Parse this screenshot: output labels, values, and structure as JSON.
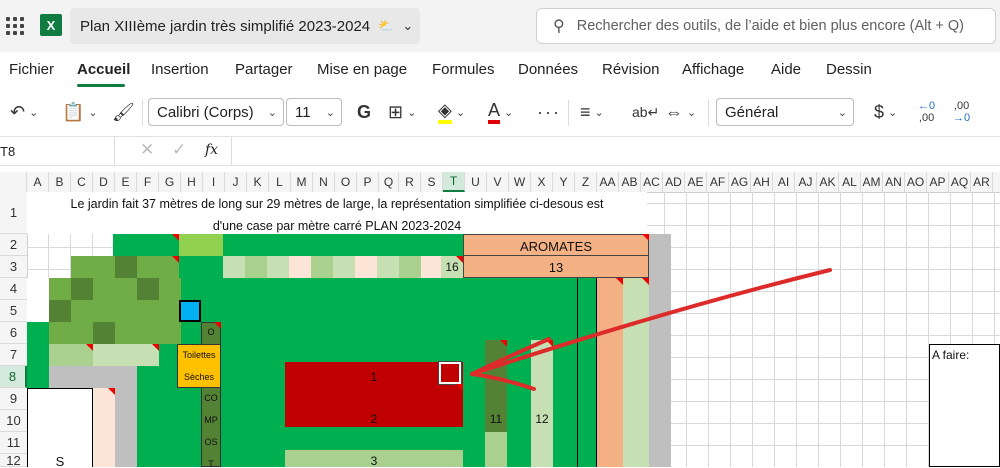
{
  "titlebar": {
    "doc_title": "Plan XIIIème jardin très simplifié 2023-2024",
    "search_placeholder": "Rechercher des outils, de l’aide et bien plus encore (Alt + Q)",
    "app_icon_letter": "X"
  },
  "menu": {
    "items": [
      "Fichier",
      "Accueil",
      "Insertion",
      "Partager",
      "Mise en page",
      "Formules",
      "Données",
      "Révision",
      "Affichage",
      "Aide",
      "Dessin"
    ],
    "active": "Accueil"
  },
  "ribbon": {
    "font_name": "Calibri (Corps)",
    "font_size": "11",
    "bold_label": "G",
    "number_format": "Général",
    "currency_symbol": "$",
    "decimal_decrease_label": ",00",
    "decimal_increase_label": ",00"
  },
  "formula_bar": {
    "name_box": "T8",
    "fx_label": "fx"
  },
  "sheet": {
    "columns": [
      "A",
      "B",
      "C",
      "D",
      "E",
      "F",
      "G",
      "H",
      "I",
      "J",
      "K",
      "L",
      "M",
      "N",
      "O",
      "P",
      "Q",
      "R",
      "S",
      "T",
      "U",
      "V",
      "W",
      "X",
      "Y",
      "Z",
      "AA",
      "AB",
      "AC",
      "AD",
      "AE",
      "AF",
      "AG",
      "AH",
      "AI",
      "AJ",
      "AK",
      "AL",
      "AM",
      "AN",
      "AO",
      "AP",
      "AQ",
      "AR"
    ],
    "selected_column": "T",
    "rows": [
      "1",
      "2",
      "3",
      "4",
      "5",
      "6",
      "7",
      "8",
      "9",
      "10",
      "11",
      "12"
    ],
    "selected_row": "8",
    "title_line1": "Le jardin fait 37 mètres de long sur 29 mètres de large, la représentation simplifiée ci-desous est",
    "title_line2": "d'une case par mètre carré PLAN 2023-2024",
    "aromates_label": "AROMATES",
    "aromates_number": "13",
    "bed_16": "16",
    "toilettes_1": "Toilettes",
    "toilettes_2": "Sèches",
    "compost_letters": [
      "O",
      "CO",
      "MP",
      "OS",
      "T"
    ],
    "bed_1": "1",
    "bed_2": "2",
    "bed_3": "3",
    "bed_11": "11",
    "bed_12": "12",
    "row12_label": "S",
    "a_faire": "A faire:"
  },
  "colors": {
    "excel_green": "#107c41",
    "garden_green": "#00b050",
    "dark_green": "#548235",
    "light_green": "#a9d08e",
    "pale_green": "#c6e0b4",
    "red": "#c00000",
    "salmon": "#f4b183",
    "peach": "#fce4d6",
    "yellow": "#ffc000",
    "blue": "#00b0f0",
    "gray": "#bfbfbf",
    "arrow_red": "#dd2a2a"
  }
}
